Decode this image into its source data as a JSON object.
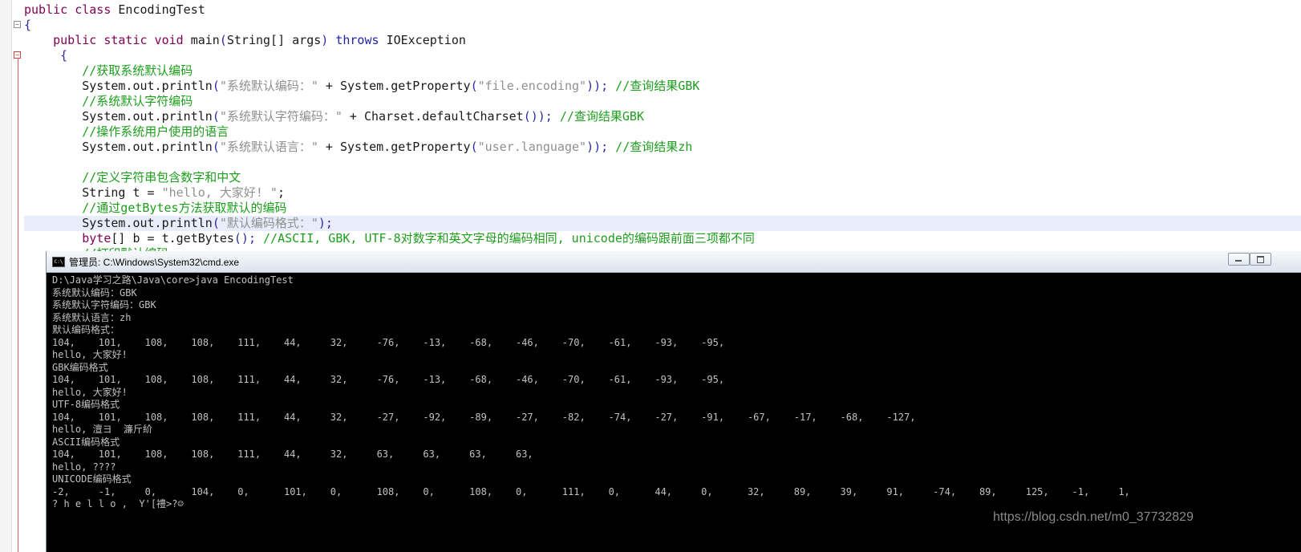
{
  "editor": {
    "lines": [
      {
        "segments": [
          {
            "t": "public class ",
            "c": "kw"
          },
          {
            "t": "EncodingTest",
            "c": ""
          }
        ]
      },
      {
        "segments": [
          {
            "t": "{",
            "c": "paren"
          }
        ]
      },
      {
        "segments": [
          {
            "t": "    public static void ",
            "c": "kw"
          },
          {
            "t": "main",
            "c": ""
          },
          {
            "t": "(",
            "c": "paren"
          },
          {
            "t": "String[] args",
            "c": ""
          },
          {
            "t": ")",
            "c": "paren"
          },
          {
            "t": " throws ",
            "c": "kw-navy"
          },
          {
            "t": "IOException",
            "c": ""
          }
        ]
      },
      {
        "segments": [
          {
            "t": "     {",
            "c": "paren"
          }
        ]
      },
      {
        "segments": [
          {
            "t": "        //获取系统默认编码",
            "c": "cmt"
          }
        ]
      },
      {
        "segments": [
          {
            "t": "        System.out.println",
            "c": ""
          },
          {
            "t": "(",
            "c": "paren"
          },
          {
            "t": "\"系统默认编码：\"",
            "c": "str"
          },
          {
            "t": " + System.getProperty",
            "c": ""
          },
          {
            "t": "(",
            "c": "paren"
          },
          {
            "t": "\"file.encoding\"",
            "c": "str"
          },
          {
            "t": "));",
            "c": "paren"
          },
          {
            "t": " //查询结果GBK",
            "c": "cmt"
          }
        ]
      },
      {
        "segments": [
          {
            "t": "        //系统默认字符编码",
            "c": "cmt"
          }
        ]
      },
      {
        "segments": [
          {
            "t": "        System.out.println",
            "c": ""
          },
          {
            "t": "(",
            "c": "paren"
          },
          {
            "t": "\"系统默认字符编码：\"",
            "c": "str"
          },
          {
            "t": " + Charset.defaultCharset",
            "c": ""
          },
          {
            "t": "());",
            "c": "paren"
          },
          {
            "t": " //查询结果GBK",
            "c": "cmt"
          }
        ]
      },
      {
        "segments": [
          {
            "t": "        //操作系统用户使用的语言",
            "c": "cmt"
          }
        ]
      },
      {
        "segments": [
          {
            "t": "        System.out.println",
            "c": ""
          },
          {
            "t": "(",
            "c": "paren"
          },
          {
            "t": "\"系统默认语言：\"",
            "c": "str"
          },
          {
            "t": " + System.getProperty",
            "c": ""
          },
          {
            "t": "(",
            "c": "paren"
          },
          {
            "t": "\"user.language\"",
            "c": "str"
          },
          {
            "t": "));",
            "c": "paren"
          },
          {
            "t": " //查询结果zh",
            "c": "cmt"
          }
        ]
      },
      {
        "segments": [
          {
            "t": "",
            "c": ""
          }
        ]
      },
      {
        "segments": [
          {
            "t": "        //定义字符串包含数字和中文",
            "c": "cmt"
          }
        ]
      },
      {
        "segments": [
          {
            "t": "        String t = ",
            "c": ""
          },
          {
            "t": "\"hello, 大家好! \"",
            "c": "str"
          },
          {
            "t": ";",
            "c": ""
          }
        ]
      },
      {
        "segments": [
          {
            "t": "        //通过getBytes方法获取默认的编码",
            "c": "cmt"
          }
        ]
      },
      {
        "segments": [
          {
            "t": "        System.out.println",
            "c": ""
          },
          {
            "t": "(",
            "c": "paren"
          },
          {
            "t": "\"默认编码格式：\"",
            "c": "str"
          },
          {
            "t": ");",
            "c": "paren"
          }
        ],
        "current": true
      },
      {
        "segments": [
          {
            "t": "        byte",
            "c": "kw"
          },
          {
            "t": "[] b = t.getBytes",
            "c": ""
          },
          {
            "t": "();",
            "c": "paren"
          },
          {
            "t": " //ASCII, GBK, UTF-8对数字和英文字母的编码相同, unicode的编码跟前面三项都不同",
            "c": "cmt"
          }
        ]
      },
      {
        "segments": [
          {
            "t": "        //打印默认编码",
            "c": "cmt"
          }
        ]
      }
    ]
  },
  "cmd": {
    "title": "管理员: C:\\Windows\\System32\\cmd.exe",
    "lines": [
      "D:\\Java学习之路\\Java\\core>java EncodingTest",
      "系统默认编码：GBK",
      "系统默认字符编码：GBK",
      "系统默认语言：zh",
      "默认编码格式：",
      "104,    101,    108,    108,    111,    44,     32,     -76,    -13,    -68,    -46,    -70,    -61,    -93,    -95,",
      "hello, 大家好!",
      "GBK编码格式",
      "104,    101,    108,    108,    111,    44,     32,     -76,    -13,    -68,    -46,    -70,    -61,    -93,    -95,",
      "hello, 大家好!",
      "UTF-8编码格式",
      "104,    101,    108,    108,    111,    44,     32,     -27,    -92,    -89,    -27,    -82,    -74,    -27,    -91,    -67,    -17,    -68,    -127,",
      "hello, 澶ヨ  濂斤紒",
      "ASCII编码格式",
      "104,    101,    108,    108,    111,    44,     32,     63,     63,     63,     63,",
      "hello, ????",
      "UNICODE编码格式",
      "-2,     -1,     0,      104,    0,      101,    0,      108,    0,      108,    0,      111,    0,      44,     0,      32,     89,     39,     91,     -74,    89,     125,    -1,     1,",
      "? h e l l o ,  Y'[禮>?☺"
    ]
  },
  "watermark": "https://blog.csdn.net/m0_37732829"
}
